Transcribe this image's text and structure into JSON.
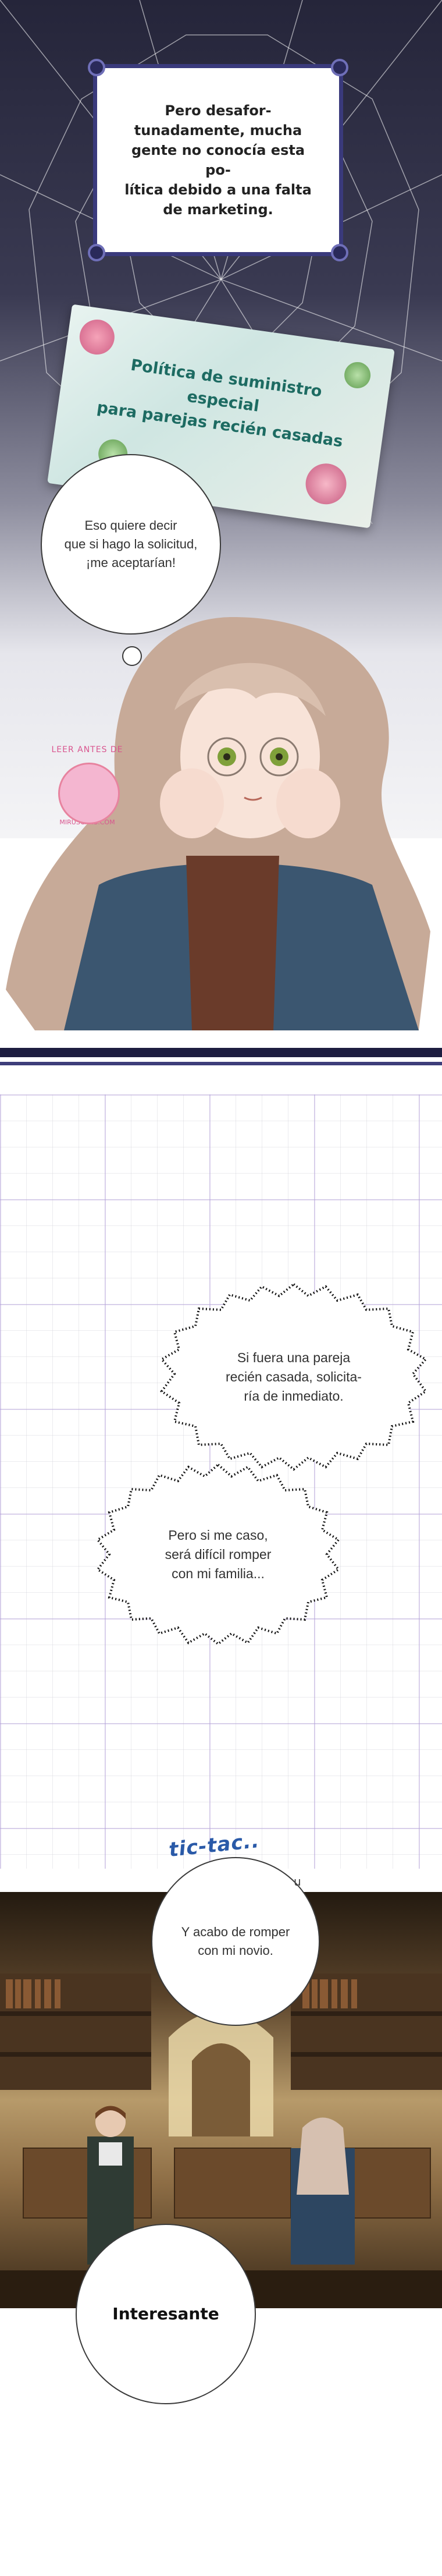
{
  "panel1": {
    "narration": "Pero desafor-\ntunadamente, mucha\ngente no conocía esta po-\nlítica debido a una falta\nde marketing.",
    "paper_text": "Política de suministro especial\npara parejas recién casadas",
    "bubble": "Eso quiere decir\nque si hago la solicitud,\n¡me aceptarían!",
    "watermark_top": "LEER ANTES DE",
    "watermark_bottom": "MIRUSCANS.COM"
  },
  "panel2": {
    "bubble1": "Si fuera una pareja\nrecién casada, solicita-\nría de inmediato.",
    "bubble2": "Pero si me caso,\nserá difícil romper\ncon mi familia..."
  },
  "panel3": {
    "sfx": "tic-tac..",
    "bubble_small_mark": "u",
    "bubble": "Y acabo de romper\ncon mi novio.",
    "final_bubble": "Interesante"
  },
  "colors": {
    "frame_navy": "#3a3a7c",
    "paper_text_teal": "#1d6b62",
    "sfx_blue": "#2a5aa8",
    "grid_purple": "#b4a0dc"
  }
}
